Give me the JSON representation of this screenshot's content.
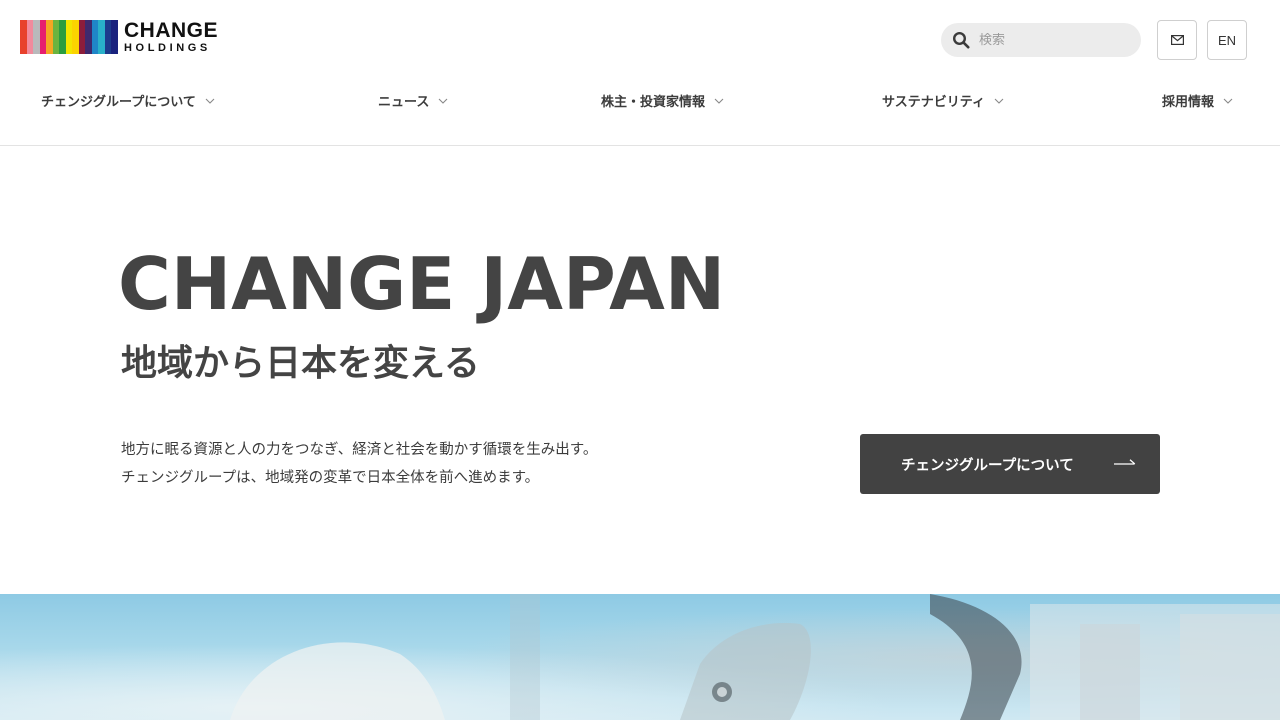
{
  "brand": {
    "name": "CHANGE",
    "sub": "HOLDINGS",
    "stripe_colors": [
      "#e8412c",
      "#f18a9c",
      "#b9b9bb",
      "#e61e6e",
      "#f5a623",
      "#6bb43f",
      "#2a9d3f",
      "#f2e600",
      "#fbd400",
      "#8b1d3b",
      "#3d2a6e",
      "#1f86c8",
      "#29b1c9",
      "#1d3b8c",
      "#1a237e"
    ]
  },
  "search": {
    "placeholder": "検索",
    "icon": "search-icon"
  },
  "header_buttons": {
    "mail_icon": "mail-icon",
    "language": "EN"
  },
  "nav": [
    {
      "label": "チェンジグループについて"
    },
    {
      "label": "ニュース"
    },
    {
      "label": "株主・投資家情報"
    },
    {
      "label": "サステナビリティ"
    },
    {
      "label": "採用情報"
    }
  ],
  "hero": {
    "title": "CHANGE JAPAN",
    "subtitle": "地域から日本を変える",
    "description": [
      "地方に眠る資源と人の力をつなぎ、経済と社会を動かす循環を生み出す。",
      "チェンジグループは、地域発の変革で日本全体を前へ進めます。"
    ],
    "cta_label": "チェンジグループについて"
  },
  "colors": {
    "text": "#3c3c3c",
    "cta_bg": "#424242",
    "search_bg": "#ececec"
  }
}
